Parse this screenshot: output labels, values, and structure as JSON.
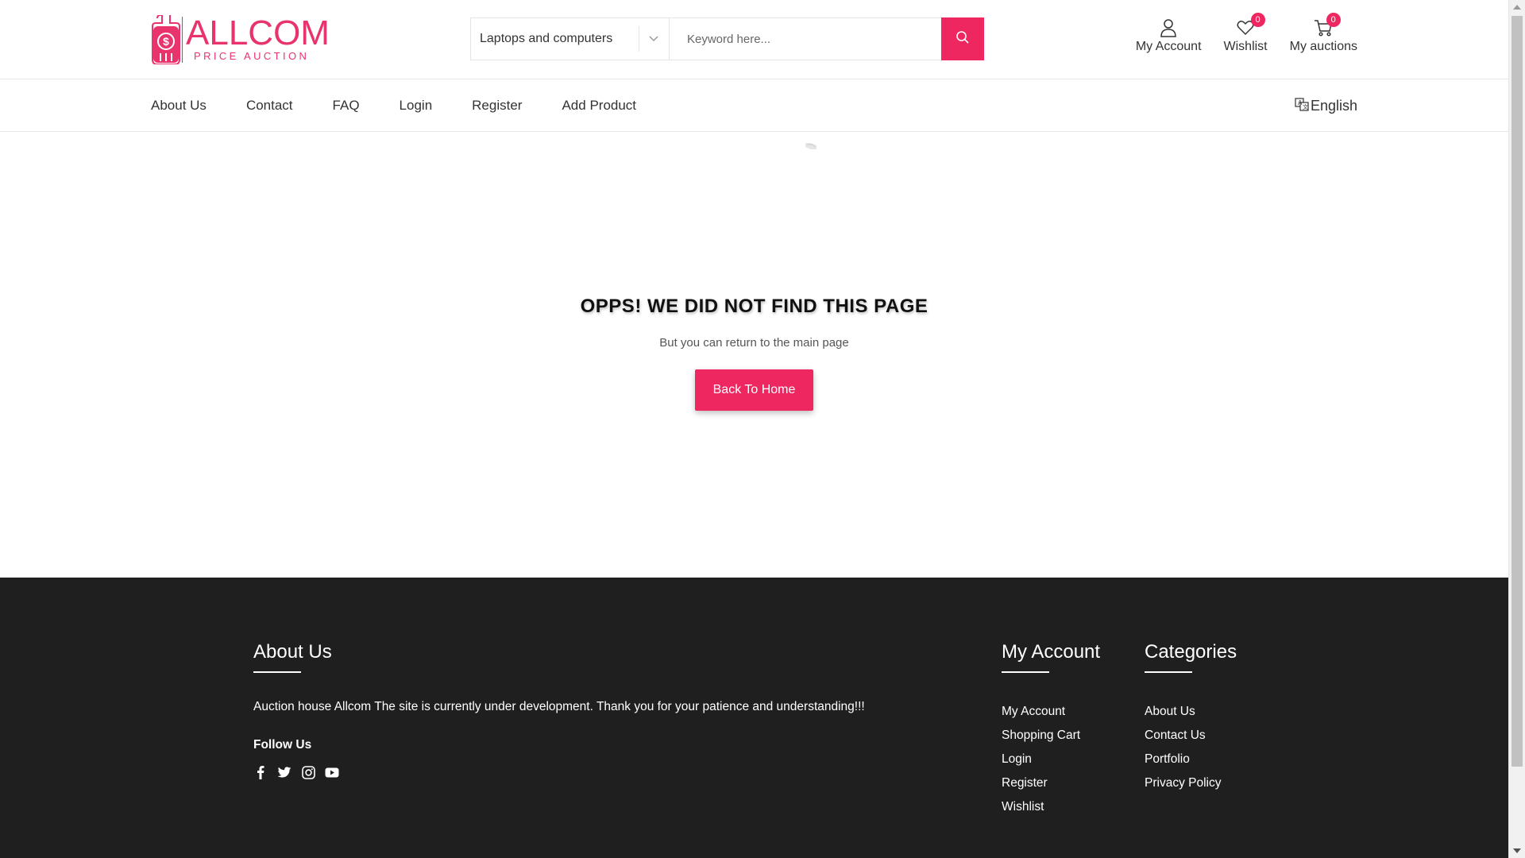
{
  "brand": {
    "name": "ALLCOM",
    "tagline": "PRICE AUCTION",
    "accent": "#ee2761"
  },
  "search": {
    "category_selected": "Laptops and computers",
    "placeholder": "Keyword here..."
  },
  "header_icons": {
    "account_label": "My Account",
    "wishlist_label": "Wishlist",
    "wishlist_count": "0",
    "auctions_label": "My auctions",
    "auctions_count": "0"
  },
  "nav": {
    "items": [
      {
        "label": "About Us"
      },
      {
        "label": "Contact"
      },
      {
        "label": "FAQ"
      },
      {
        "label": "Login"
      },
      {
        "label": "Register"
      },
      {
        "label": "Add Product"
      }
    ],
    "language": "English"
  },
  "error": {
    "title": "OPPS! WE DID NOT FIND THIS PAGE",
    "subtitle": "But you can return to the main page",
    "button": "Back To Home"
  },
  "footer": {
    "about": {
      "heading": "About Us",
      "text": "Auction house Allcom The site is currently under development. Thank you for your patience and understanding!!!",
      "follow": "Follow Us",
      "social": [
        "facebook-icon",
        "twitter-icon",
        "instagram-icon",
        "youtube-icon"
      ]
    },
    "account": {
      "heading": "My Account",
      "links": [
        {
          "label": "My Account"
        },
        {
          "label": "Shopping Cart"
        },
        {
          "label": "Login"
        },
        {
          "label": "Register"
        },
        {
          "label": "Wishlist"
        }
      ]
    },
    "categories": {
      "heading": "Categories",
      "links": [
        {
          "label": "About Us"
        },
        {
          "label": "Contact Us"
        },
        {
          "label": "Portfolio"
        },
        {
          "label": "Privacy Policy"
        }
      ]
    },
    "background": "#1f1f1f"
  }
}
